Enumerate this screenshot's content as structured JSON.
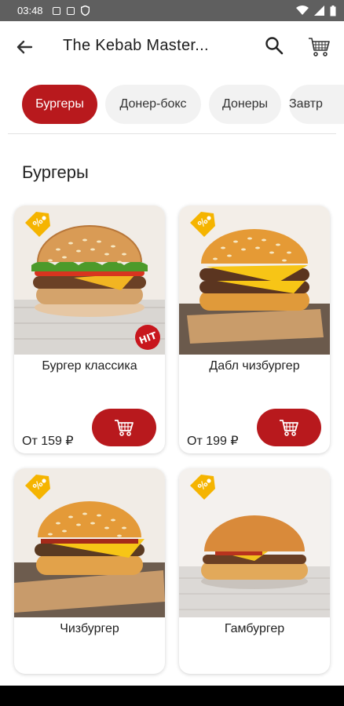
{
  "status_bar": {
    "time": "03:48"
  },
  "app_bar": {
    "title": "The Kebab Master..."
  },
  "tabs": [
    {
      "label": "Бургеры",
      "active": true
    },
    {
      "label": "Донер-бокс",
      "active": false
    },
    {
      "label": "Донеры",
      "active": false
    },
    {
      "label": "Завтр",
      "active": false
    }
  ],
  "section": {
    "title": "Бургеры"
  },
  "products": [
    {
      "name": "Бургер классика",
      "price": "От 159 ₽",
      "badge": "HIT"
    },
    {
      "name": "Дабл чизбургер",
      "price": "От 199 ₽"
    },
    {
      "name": "Чизбургер",
      "price": ""
    },
    {
      "name": "Гамбургер",
      "price": ""
    }
  ],
  "colors": {
    "accent": "#b8191d",
    "chip_bg": "#f2f2f2",
    "tag": "#f5b400",
    "status_bar": "#5f5f5f"
  },
  "icons": {
    "back": "arrow-left-icon",
    "search": "search-icon",
    "cart": "shopping-cart-icon",
    "add": "add-to-cart-icon",
    "discount": "discount-tag-icon"
  }
}
